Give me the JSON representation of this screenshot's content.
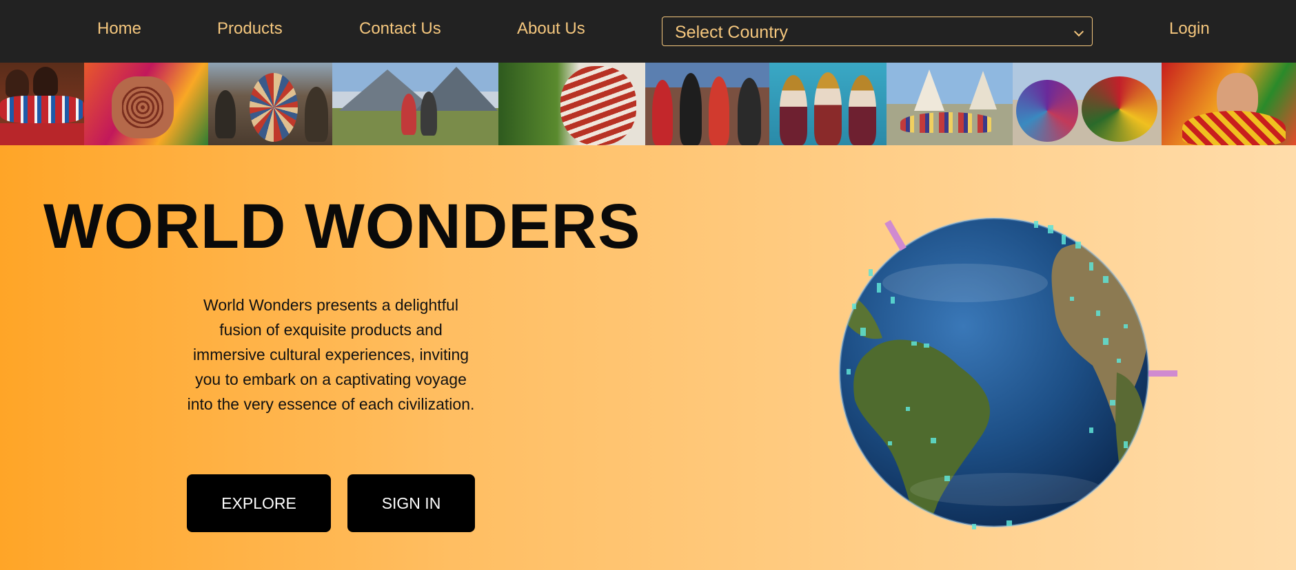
{
  "nav": {
    "links": [
      "Home",
      "Products",
      "Contact Us",
      "About Us"
    ],
    "country_select": {
      "selected": "Select Country"
    },
    "login_label": "Login"
  },
  "banner": {
    "tiles": [
      {
        "name": "maasai-women"
      },
      {
        "name": "henna-hands"
      },
      {
        "name": "powwow-dancer"
      },
      {
        "name": "mountain-couple"
      },
      {
        "name": "painted-face"
      },
      {
        "name": "maasai-group"
      },
      {
        "name": "crowned-women"
      },
      {
        "name": "tipi-gathering"
      },
      {
        "name": "folklorico-dancers"
      },
      {
        "name": "festival-dancer"
      }
    ]
  },
  "hero": {
    "title": "WORLD WONDERS",
    "description": "World Wonders presents a delightful fusion of exquisite products and immersive cultural experiences, inviting you to embark on a captivating voyage into the very essence of each civilization.",
    "buttons": {
      "explore": "EXPLORE",
      "sign_in": "SIGN IN"
    }
  },
  "colors": {
    "nav_bg": "#222222",
    "nav_text": "#f5c77e",
    "hero_gradient_start": "#ffa527",
    "hero_gradient_end": "#ffdcaa",
    "button_bg": "#000000",
    "button_text": "#ffffff",
    "globe_ocean": "#1d4f86",
    "globe_land": "#4f6b2e",
    "globe_markers": "#5fe3d6",
    "globe_arcs": "#d08ad0"
  }
}
